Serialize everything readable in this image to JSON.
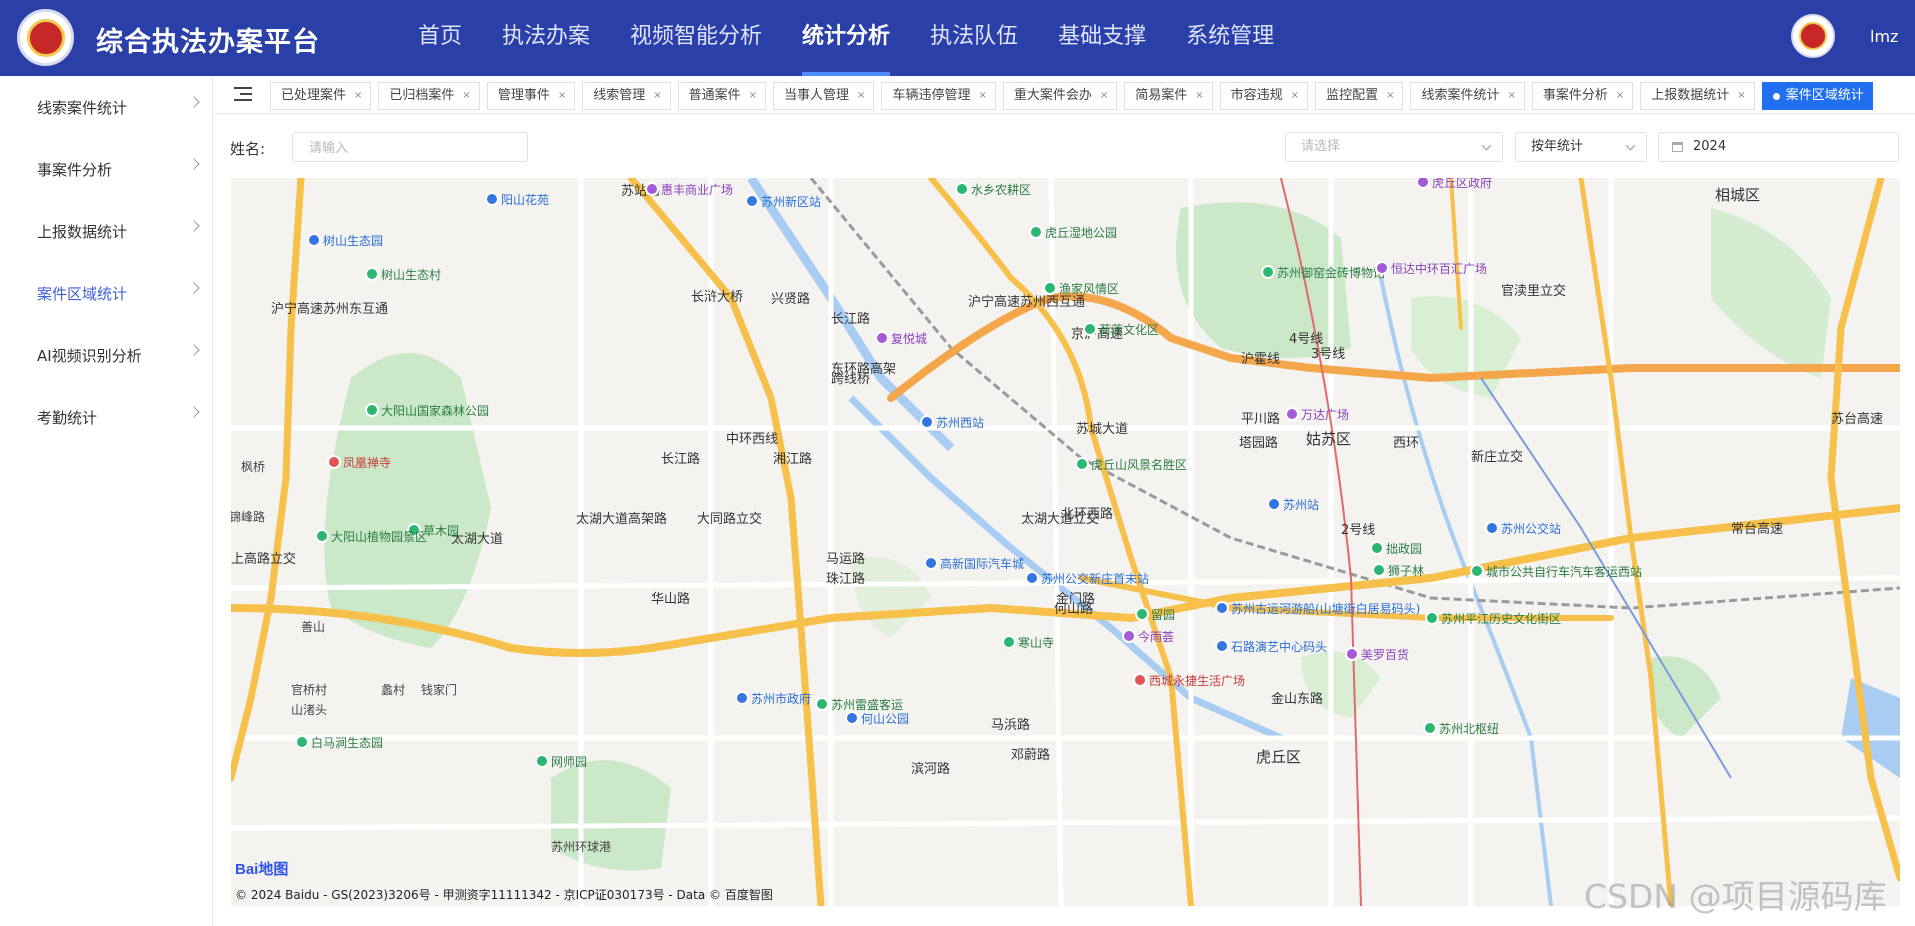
{
  "header": {
    "app_title": "综合执法办案平台",
    "nav": [
      "首页",
      "执法办案",
      "视频智能分析",
      "统计分析",
      "执法队伍",
      "基础支撑",
      "系统管理"
    ],
    "nav_active_index": 3,
    "username": "lmz"
  },
  "sidebar": {
    "items": [
      {
        "label": "线索案件统计",
        "active": false
      },
      {
        "label": "事案件分析",
        "active": false
      },
      {
        "label": "上报数据统计",
        "active": false
      },
      {
        "label": "案件区域统计",
        "active": true
      },
      {
        "label": "AI视频识别分析",
        "active": false
      },
      {
        "label": "考勤统计",
        "active": false
      }
    ]
  },
  "tabs": [
    {
      "label": "已处理案件",
      "active": false
    },
    {
      "label": "已归档案件",
      "active": false
    },
    {
      "label": "管理事件",
      "active": false
    },
    {
      "label": "线索管理",
      "active": false
    },
    {
      "label": "普通案件",
      "active": false
    },
    {
      "label": "当事人管理",
      "active": false
    },
    {
      "label": "车辆违停管理",
      "active": false
    },
    {
      "label": "重大案件会办",
      "active": false
    },
    {
      "label": "简易案件",
      "active": false
    },
    {
      "label": "市容违规",
      "active": false
    },
    {
      "label": "监控配置",
      "active": false
    },
    {
      "label": "线索案件统计",
      "active": false
    },
    {
      "label": "事案件分析",
      "active": false
    },
    {
      "label": "上报数据统计",
      "active": false
    },
    {
      "label": "案件区域统计",
      "active": true
    }
  ],
  "tab_close_glyph": "×",
  "filter": {
    "name_label": "姓名:",
    "name_placeholder": "请输入",
    "name_value": "",
    "select_placeholder": "请选择",
    "period_value": "按年统计",
    "year_value": "2024"
  },
  "map": {
    "district_labels": [
      "相城区",
      "姑苏区",
      "虎丘区"
    ],
    "road_labels": [
      "太湖大道",
      "太湖大道高架路",
      "中环西线",
      "北环西路",
      "苏城大道",
      "京沪高速",
      "沪宁高速苏州西互通",
      "沪宁高速苏州东互通",
      "苏台高速",
      "常台高速",
      "东环路高架",
      "长江路",
      "湘江路",
      "珠江路",
      "华山路",
      "金门路",
      "何山路",
      "马运路",
      "塔园路",
      "西环",
      "平川路",
      "苏站路",
      "兴贤路",
      "长浒大桥",
      "大同路立交",
      "太湖大道立交",
      "新庄立交",
      "官渎里立交",
      "上高路立交",
      "马浜路",
      "邓蔚路",
      "金山东路",
      "滨河路",
      "长江路",
      "沪霍线",
      "跨线桥",
      "3号线",
      "4号线",
      "2号线"
    ],
    "poi_labels": [
      "阳山花苑",
      "惠丰商业广场",
      "苏州新区站",
      "水乡农耕区",
      "虎丘湿地公园",
      "渔家风情区",
      "荷莲文化区",
      "苏州御窑金砖博物馆",
      "恒达中环百汇广场",
      "树山生态园",
      "树山生态村",
      "大阳山国家森林公园",
      "凤凰禅寺",
      "草木园",
      "大阳山植物园景区",
      "复悦城",
      "苏州西站",
      "万达广场",
      "虎丘山风景名胜区",
      "苏州站",
      "苏州公交站",
      "拙政园",
      "狮子林",
      "苏州古运河游船(山塘街白居易码头)",
      "苏州平江历史文化街区",
      "今雨荟",
      "石路演艺中心码头",
      "美罗百货",
      "高新国际汽车城",
      "苏州公交新庄首末站",
      "留园",
      "寒山寺",
      "西城永捷生活广场",
      "苏州市政府",
      "苏州雷盛客运",
      "何山公园",
      "城市公共自行车汽车客运西站",
      "苏州北枢纽",
      "网师园",
      "白马涧生态园",
      "善山",
      "官桥村",
      "山渚头",
      "蠡村",
      "钱家门",
      "枫桥",
      "锦峰路",
      "虎丘区政府",
      "苏州环球港"
    ],
    "baidu_logo": "Bai地图",
    "copyright": "© 2024 Baidu - GS(2023)3206号 - 甲测资字11111342 - 京ICP证030173号 - Data © 百度智图"
  },
  "watermark": "CSDN @项目源码库"
}
